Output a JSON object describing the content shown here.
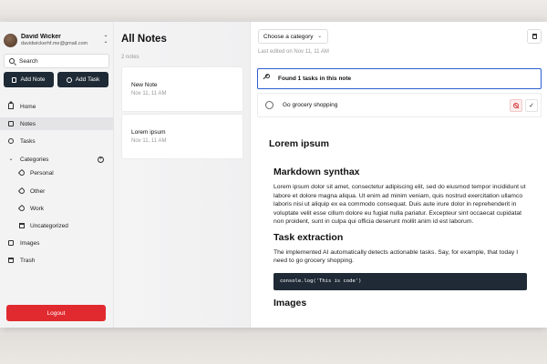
{
  "user": {
    "name": "David Wicker",
    "email": "davidwickerhf.me@gmail.com"
  },
  "search": {
    "placeholder": "Search"
  },
  "actions": {
    "add_note": "Add Note",
    "add_task": "Add Task"
  },
  "nav": {
    "home": "Home",
    "notes": "Notes",
    "tasks": "Tasks",
    "categories": "Categories",
    "category_items": [
      "Personal",
      "Other",
      "Work",
      "Uncategorized"
    ],
    "images": "Images",
    "trash": "Trash"
  },
  "logout": "Logout",
  "notes_list": {
    "title": "All Notes",
    "count": "2 notes",
    "items": [
      {
        "title": "New Note",
        "date": "Nov 11, 11 AM"
      },
      {
        "title": "Lorem ipsum",
        "date": "Nov 11, 11 AM"
      }
    ]
  },
  "editor": {
    "category_placeholder": "Choose a category",
    "last_edited": "Last edited on Nov 11, 11 AM",
    "task_panel_title": "Found 1 tasks in this note",
    "tasks": [
      "Go grocery shopping"
    ],
    "doc": {
      "title": "Lorem ipsum",
      "h2_markdown": "Markdown synthax",
      "p1": "Lorem ipsum dolor sit amet, consectetur adipiscing elit, sed do eiusmod tempor incididunt ut labore et dolore magna aliqua. Ut enim ad minim veniam, quis nostrud exercitation ullamco laboris nisi ut aliquip ex ea commodo consequat. Duis aute irure dolor in reprehenderit in voluptate velit esse cillum dolore eu fugiat nulla pariatur. Excepteur sint occaecat cupidatat non proident, sunt in culpa qui officia deserunt mollit anim id est laborum.",
      "h2_tasks": "Task extraction",
      "p2": "The implemented AI automatically detects actionable tasks. Say, for example, that today I need to go grocery shopping.",
      "code": "console.log('This is code')",
      "h2_images": "Images"
    }
  },
  "colors": {
    "primary_dark": "#1e2a35",
    "danger": "#e12a2f",
    "focus_blue": "#2c5fd1"
  },
  "icons": [
    "search-icon",
    "note-icon",
    "check-circle-icon",
    "home-icon",
    "chevron-down-icon",
    "tag-icon",
    "box-icon",
    "image-icon",
    "trash-icon",
    "plus-circle-icon",
    "wand-icon",
    "ban-icon",
    "check-icon"
  ]
}
